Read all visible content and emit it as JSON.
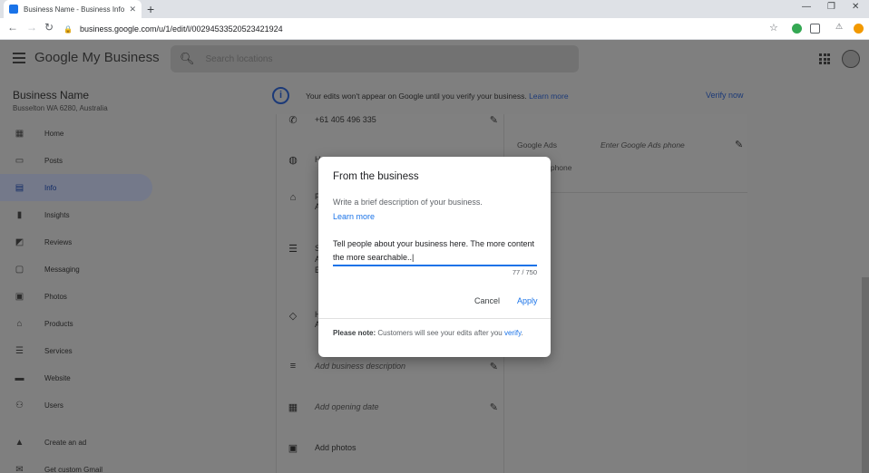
{
  "browser": {
    "tab_title": "Business Name - Business Info",
    "new_tab": "+",
    "url": "business.google.com/u/1/edit/l/00294533520523421924"
  },
  "header": {
    "logo_google": "Google",
    "logo_rest": " My Business",
    "search_placeholder": "Search locations"
  },
  "sidebar": {
    "business_name": "Business Name",
    "business_address": "Busselton WA 6280, Australia",
    "items": [
      {
        "label": "Home",
        "icon": "dashboard-icon"
      },
      {
        "label": "Posts",
        "icon": "posts-icon"
      },
      {
        "label": "Info",
        "icon": "storefront-icon"
      },
      {
        "label": "Insights",
        "icon": "bar-chart-icon"
      },
      {
        "label": "Reviews",
        "icon": "reviews-icon"
      },
      {
        "label": "Messaging",
        "icon": "message-icon"
      },
      {
        "label": "Photos",
        "icon": "photos-icon"
      },
      {
        "label": "Products",
        "icon": "basket-icon"
      },
      {
        "label": "Services",
        "icon": "list-icon"
      },
      {
        "label": "Website",
        "icon": "website-icon"
      },
      {
        "label": "Users",
        "icon": "add-user-icon"
      },
      {
        "label": "Create an ad",
        "icon": "ads-icon"
      },
      {
        "label": "Get custom Gmail",
        "icon": "mail-icon"
      }
    ],
    "active_index": 2
  },
  "banner": {
    "text": "Your edits won't appear on Google until you verify your business.",
    "link": "Learn more",
    "verify": "Verify now"
  },
  "info_card": {
    "phone": "+61 405 496 335",
    "row_h": "H",
    "row_p": "P",
    "row_a1": "A",
    "row_s": "S",
    "row_a2": "A",
    "row_e": "E",
    "row_h2": "H",
    "row_a3": "A",
    "add_description": "Add business description",
    "add_opening_date": "Add opening date",
    "add_photos": "Add photos"
  },
  "right_card": {
    "google_ads_label": "Google Ads",
    "google_ads_value": "Enter Google Ads phone",
    "business_phone": "Business phone"
  },
  "dialog": {
    "title": "From the business",
    "subtitle": "Write a brief description of your business.",
    "learn_more": "Learn more",
    "text": "Tell people about your business here. The more content the more searchable..|",
    "count": "77 / 750",
    "cancel": "Cancel",
    "apply": "Apply",
    "note_bold": "Please note:",
    "note_text": " Customers will see your edits after you ",
    "note_link": "verify",
    "note_end": "."
  },
  "colors": {
    "accent": "#1a73e8",
    "overlay": "#7f7f7f"
  }
}
